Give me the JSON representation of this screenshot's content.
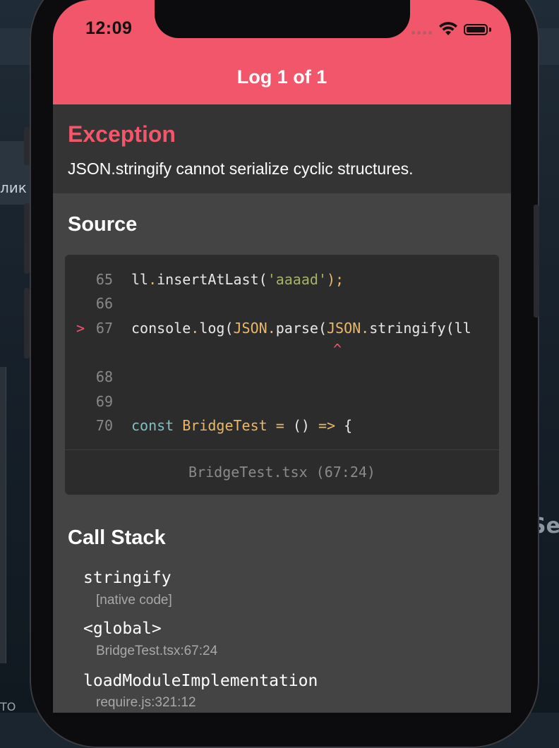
{
  "background": {
    "left_text": "лик",
    "right_text": "Se",
    "bottom_left_text": "ТО"
  },
  "status_bar": {
    "time": "12:09"
  },
  "header": {
    "title": "Log 1 of 1",
    "color": "#f1566a"
  },
  "exception": {
    "label": "Exception",
    "message": "JSON.stringify cannot serialize cyclic structures."
  },
  "source": {
    "heading": "Source",
    "marker": ">",
    "caret": "^",
    "lines": [
      {
        "number": "65"
      },
      {
        "number": "66"
      },
      {
        "number": "67"
      },
      {
        "number": "68"
      },
      {
        "number": "69"
      },
      {
        "number": "70"
      }
    ],
    "tokens": {
      "l65_a": "ll",
      "l65_dot": ".",
      "l65_b": "insertAtLast(",
      "l65_str": "'aaaad'",
      "l65_end": ");",
      "l67_a": "console",
      "l67_dot1": ".",
      "l67_b": "log(",
      "l67_json1": "JSON",
      "l67_dot2": ".",
      "l67_c": "parse(",
      "l67_json2": "JSON",
      "l67_dot3": ".",
      "l67_d": "stringify(ll",
      "l70_const": "const",
      "l70_name": "BridgeTest",
      "l70_eq": "=",
      "l70_paren": "()",
      "l70_arrow": "=>",
      "l70_brace": "{"
    },
    "file_location": "BridgeTest.tsx (67:24)"
  },
  "call_stack": {
    "heading": "Call Stack",
    "frames": [
      {
        "function": "stringify",
        "location": "[native code]"
      },
      {
        "function": "<global>",
        "location": "BridgeTest.tsx:67:24"
      },
      {
        "function": "loadModuleImplementation",
        "location": "require.js:321:12"
      }
    ]
  }
}
